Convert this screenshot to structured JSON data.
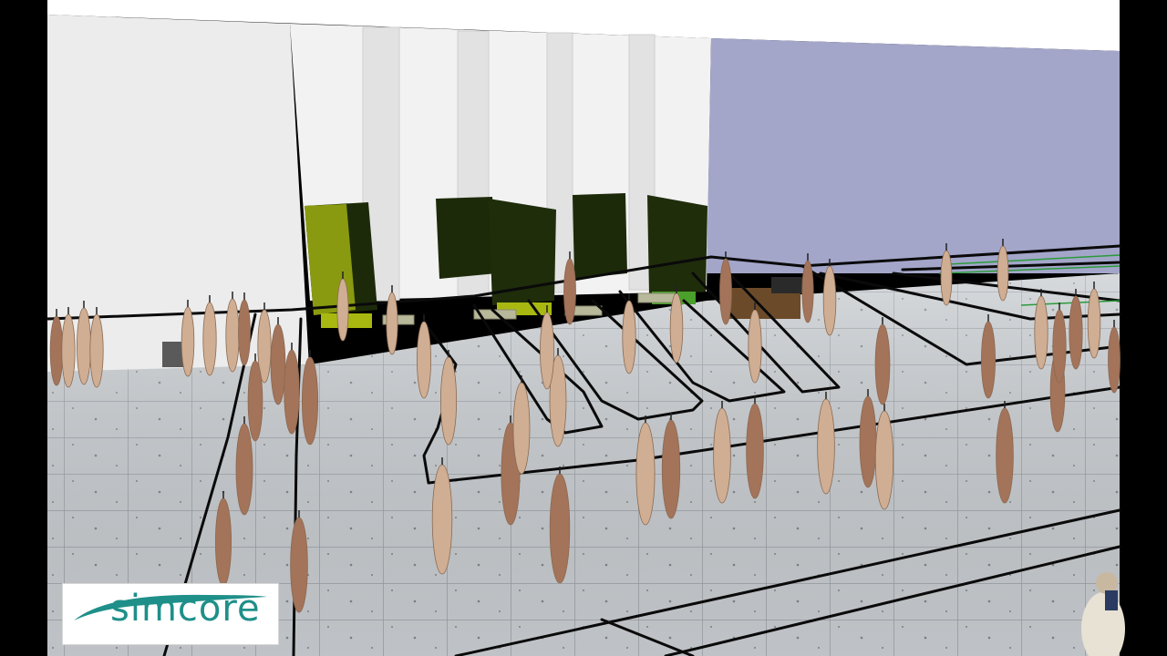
{
  "logo": {
    "text": "simcore",
    "color": "#1f8f89"
  },
  "colors": {
    "letterbox": "#000000",
    "floor": "#c9cdd1",
    "wall_left": "#eeeeee",
    "wall_right": "#a3a6c9",
    "truck": "#1d2a0a",
    "truck_cab": "#8a9a10",
    "rail": "#0a0a0a",
    "carcass": "#c9a88e"
  }
}
